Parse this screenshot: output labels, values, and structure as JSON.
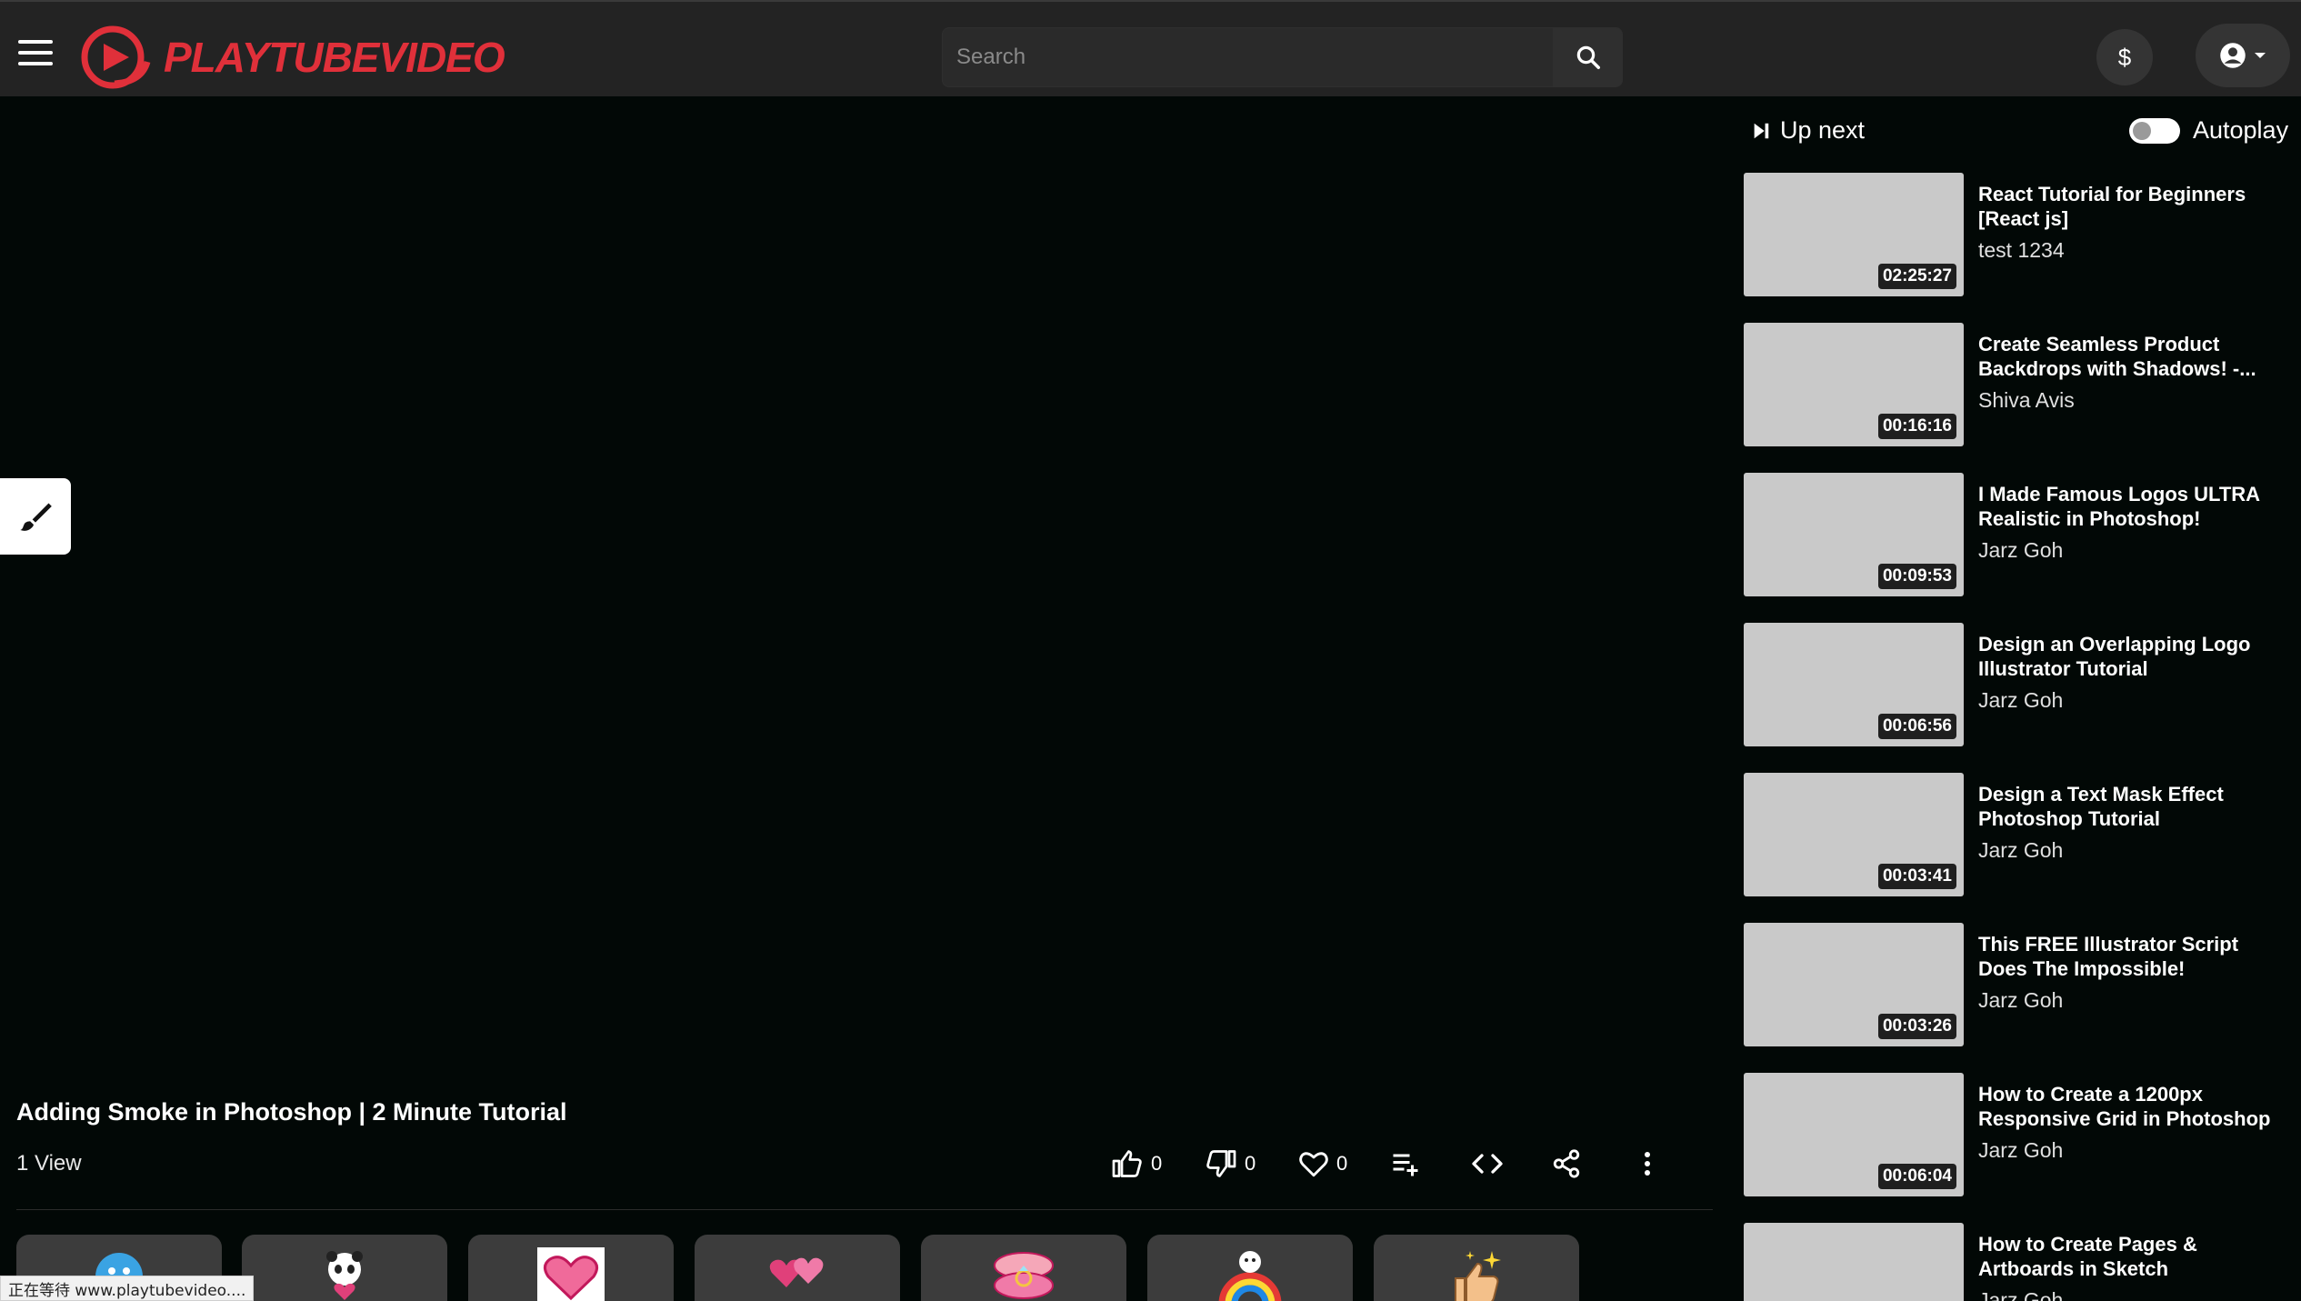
{
  "header": {
    "brand": "PLAYTUBEVIDEO",
    "search_placeholder": "Search",
    "wallet_symbol": "$"
  },
  "colors": {
    "header_bg": "#232323",
    "page_bg": "#020806",
    "brand_red": "#e0303a",
    "thumb_placeholder": "#c9c9c9"
  },
  "video": {
    "title": "Adding Smoke in Photoshop | 2 Minute Tutorial",
    "views": "1 View",
    "likes": "0",
    "dislikes": "0",
    "favorites": "0"
  },
  "sidebar": {
    "up_next_label": "Up next",
    "autoplay_label": "Autoplay",
    "autoplay_on": false,
    "items": [
      {
        "title": "React Tutorial for Beginners [React js]",
        "channel": "test 1234",
        "duration": "02:25:27"
      },
      {
        "title": "Create Seamless Product Backdrops with Shadows! -...",
        "channel": "Shiva Avis",
        "duration": "00:16:16"
      },
      {
        "title": "I Made Famous Logos ULTRA Realistic in Photoshop!",
        "channel": "Jarz Goh",
        "duration": "00:09:53"
      },
      {
        "title": "Design an Overlapping Logo Illustrator Tutorial",
        "channel": "Jarz Goh",
        "duration": "00:06:56"
      },
      {
        "title": "Design a Text Mask Effect Photoshop Tutorial",
        "channel": "Jarz Goh",
        "duration": "00:03:41"
      },
      {
        "title": "This FREE Illustrator Script Does The Impossible!",
        "channel": "Jarz Goh",
        "duration": "00:03:26"
      },
      {
        "title": "How to Create a 1200px Responsive Grid in Photoshop",
        "channel": "Jarz Goh",
        "duration": "00:06:04"
      },
      {
        "title": "How to Create Pages & Artboards in Sketch",
        "channel": "Jarz Goh",
        "duration": ""
      }
    ]
  },
  "stickers": [
    "sad-face-sticker",
    "panda-heart-sticker",
    "heart-sticker",
    "heart-balloons-sticker",
    "ring-box-sticker",
    "be-happy-rainbow-sticker",
    "thumbs-up-sparkle-sticker"
  ],
  "status_bar": "正在等待 www.playtubevideo...."
}
